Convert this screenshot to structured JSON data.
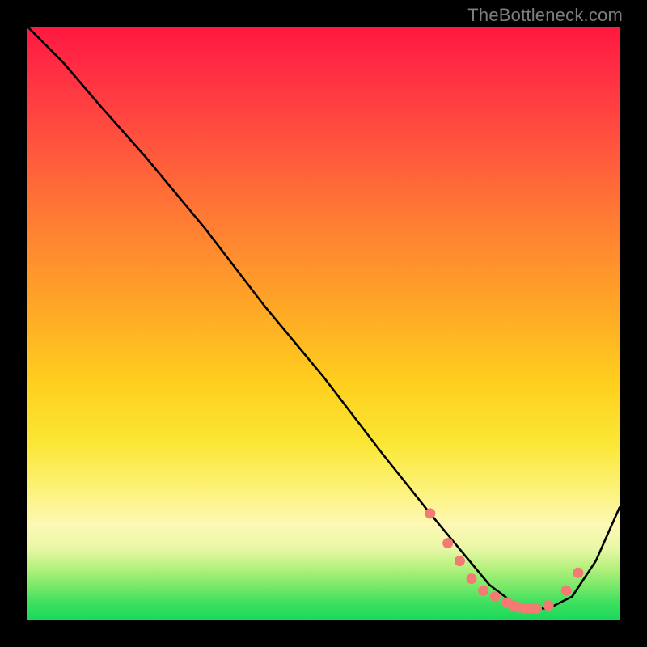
{
  "watermark": "TheBottleneck.com",
  "chart_data": {
    "type": "line",
    "title": "",
    "xlabel": "",
    "ylabel": "",
    "xlim": [
      0,
      100
    ],
    "ylim": [
      0,
      100
    ],
    "grid": false,
    "legend": false,
    "background": "vertical-gradient red→yellow→green",
    "series": [
      {
        "name": "curve",
        "color": "#000000",
        "x": [
          0,
          6,
          12,
          20,
          30,
          40,
          50,
          60,
          68,
          73,
          78,
          82,
          85,
          88,
          92,
          96,
          100
        ],
        "y": [
          100,
          94,
          87,
          78,
          66,
          53,
          41,
          28,
          18,
          12,
          6,
          3,
          2,
          2,
          4,
          10,
          19
        ]
      }
    ],
    "markers": {
      "comment": "salmon dots near the trough of the curve",
      "color": "#f47a74",
      "points": [
        {
          "x": 68,
          "y": 18
        },
        {
          "x": 71,
          "y": 13
        },
        {
          "x": 73,
          "y": 10
        },
        {
          "x": 75,
          "y": 7
        },
        {
          "x": 77,
          "y": 5
        },
        {
          "x": 79,
          "y": 4
        },
        {
          "x": 81,
          "y": 3
        },
        {
          "x": 82,
          "y": 2.5
        },
        {
          "x": 83,
          "y": 2.2
        },
        {
          "x": 84,
          "y": 2
        },
        {
          "x": 85,
          "y": 2
        },
        {
          "x": 86,
          "y": 2
        },
        {
          "x": 88,
          "y": 2.5
        },
        {
          "x": 91,
          "y": 5
        },
        {
          "x": 93,
          "y": 8
        }
      ]
    }
  }
}
